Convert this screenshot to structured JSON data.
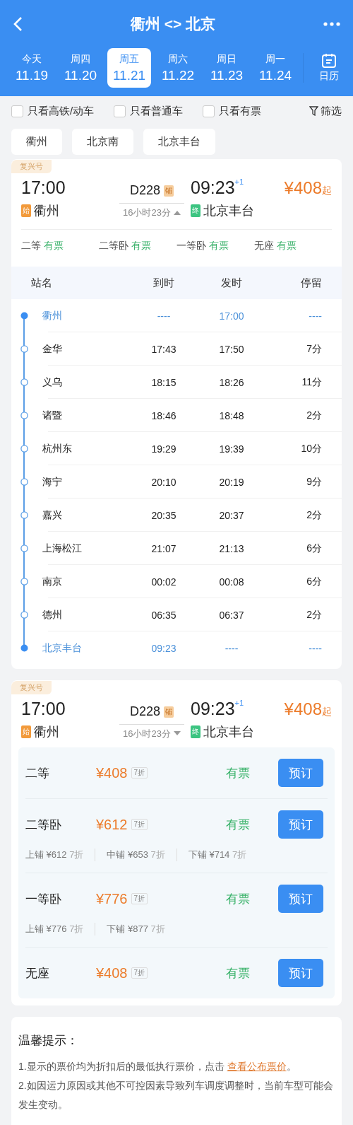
{
  "header": {
    "title": "衢州 <> 北京"
  },
  "dates": [
    {
      "weekday": "今天",
      "date": "11.19",
      "selected": false
    },
    {
      "weekday": "周四",
      "date": "11.20",
      "selected": false
    },
    {
      "weekday": "周五",
      "date": "11.21",
      "selected": true
    },
    {
      "weekday": "周六",
      "date": "11.22",
      "selected": false
    },
    {
      "weekday": "周日",
      "date": "11.23",
      "selected": false
    },
    {
      "weekday": "周一",
      "date": "11.24",
      "selected": false
    }
  ],
  "calendar_label": "日历",
  "filters": [
    {
      "label": "只看高铁/动车",
      "checked": false
    },
    {
      "label": "只看普通车",
      "checked": false
    },
    {
      "label": "只看有票",
      "checked": false
    }
  ],
  "filter_button": "筛选",
  "station_chips": [
    "衢州",
    "北京南",
    "北京丰台"
  ],
  "trains": [
    {
      "badge": "复兴号",
      "depart_time": "17:00",
      "train_no": "D228",
      "tag": "铺",
      "arrive_time": "09:23",
      "day_offset": "+1",
      "price": "¥408",
      "price_suffix": "起",
      "from_mark": "始",
      "from": "衢州",
      "duration": "16小时23分",
      "expanded": true,
      "to_mark": "终",
      "to": "北京丰台",
      "seat_summary": [
        {
          "class": "二等",
          "availability": "有票"
        },
        {
          "class": "二等卧",
          "availability": "有票"
        },
        {
          "class": "一等卧",
          "availability": "有票"
        },
        {
          "class": "无座",
          "availability": "有票"
        }
      ],
      "timetable": {
        "columns": [
          "站名",
          "到时",
          "发时",
          "停留"
        ],
        "stops": [
          {
            "kind": "endpoint",
            "name": "衢州",
            "arrive": "----",
            "depart": "17:00",
            "stay": "----"
          },
          {
            "kind": "stop",
            "name": "金华",
            "arrive": "17:43",
            "depart": "17:50",
            "stay": "7分"
          },
          {
            "kind": "stop",
            "name": "义乌",
            "arrive": "18:15",
            "depart": "18:26",
            "stay": "11分"
          },
          {
            "kind": "stop",
            "name": "诸暨",
            "arrive": "18:46",
            "depart": "18:48",
            "stay": "2分"
          },
          {
            "kind": "stop",
            "name": "杭州东",
            "arrive": "19:29",
            "depart": "19:39",
            "stay": "10分"
          },
          {
            "kind": "stop",
            "name": "海宁",
            "arrive": "20:10",
            "depart": "20:19",
            "stay": "9分"
          },
          {
            "kind": "stop",
            "name": "嘉兴",
            "arrive": "20:35",
            "depart": "20:37",
            "stay": "2分"
          },
          {
            "kind": "stop",
            "name": "上海松江",
            "arrive": "21:07",
            "depart": "21:13",
            "stay": "6分"
          },
          {
            "kind": "stop",
            "name": "南京",
            "arrive": "00:02",
            "depart": "00:08",
            "stay": "6分"
          },
          {
            "kind": "stop",
            "name": "德州",
            "arrive": "06:35",
            "depart": "06:37",
            "stay": "2分"
          },
          {
            "kind": "endpoint",
            "name": "北京丰台",
            "arrive": "09:23",
            "depart": "----",
            "stay": "----"
          }
        ]
      }
    },
    {
      "badge": "复兴号",
      "depart_time": "17:00",
      "train_no": "D228",
      "tag": "铺",
      "arrive_time": "09:23",
      "day_offset": "+1",
      "price": "¥408",
      "price_suffix": "起",
      "from_mark": "始",
      "from": "衢州",
      "duration": "16小时23分",
      "expanded": false,
      "to_mark": "终",
      "to": "北京丰台",
      "seats": [
        {
          "class": "二等",
          "price": "¥408",
          "discount": "7折",
          "availability": "有票",
          "button": "预订"
        },
        {
          "class": "二等卧",
          "price": "¥612",
          "discount": "7折",
          "availability": "有票",
          "button": "预订",
          "berths": [
            {
              "label": "上铺 ¥612",
              "discount": "7折"
            },
            {
              "label": "中铺 ¥653",
              "discount": "7折"
            },
            {
              "label": "下铺 ¥714",
              "discount": "7折"
            }
          ]
        },
        {
          "class": "一等卧",
          "price": "¥776",
          "discount": "7折",
          "availability": "有票",
          "button": "预订",
          "berths": [
            {
              "label": "上铺 ¥776",
              "discount": "7折"
            },
            {
              "label": "下铺 ¥877",
              "discount": "7折"
            }
          ]
        },
        {
          "class": "无座",
          "price": "¥408",
          "discount": "7折",
          "availability": "有票",
          "button": "预订"
        }
      ]
    }
  ],
  "tips": {
    "title": "温馨提示：",
    "items": [
      {
        "text": "1.显示的票价均为折扣后的最低执行票价，点击 ",
        "link": "查看公布票价",
        "after": "。"
      },
      {
        "text": "2.如因运力原因或其他不可控因素导致列车调度调整时，当前车型可能会发生变动。"
      }
    ]
  }
}
